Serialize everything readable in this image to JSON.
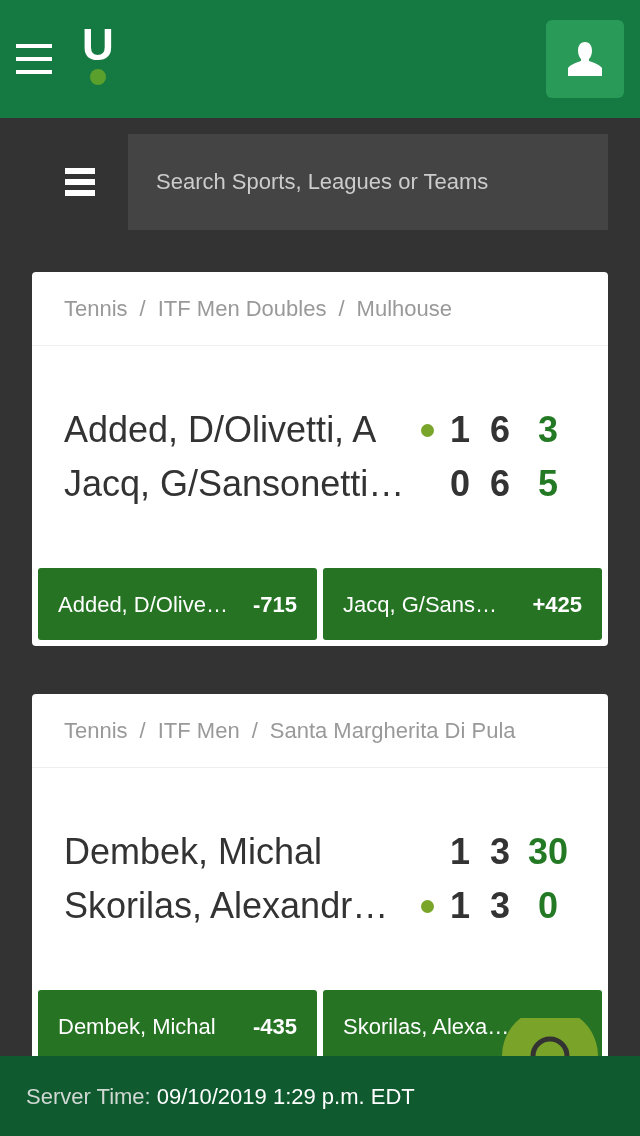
{
  "header": {
    "logo": "U"
  },
  "search": {
    "placeholder": "Search Sports, Leagues or Teams"
  },
  "events": [
    {
      "separator": "/",
      "breadcrumb": [
        "Tennis",
        "ITF Men Doubles",
        "Mulhouse"
      ],
      "players": [
        {
          "name": "Added, D/Olivetti, A",
          "serving": true,
          "sets": [
            "1",
            "6"
          ],
          "points": "3"
        },
        {
          "name": "Jacq, G/Sansonetti…",
          "serving": false,
          "sets": [
            "0",
            "6"
          ],
          "points": "5"
        }
      ],
      "odds": [
        {
          "name": "Added, D/Olive…",
          "price": "-715"
        },
        {
          "name": "Jacq, G/Sans…",
          "price": "+425"
        }
      ]
    },
    {
      "separator": "/",
      "breadcrumb": [
        "Tennis",
        "ITF Men",
        "Santa Margherita Di Pula"
      ],
      "players": [
        {
          "name": "Dembek, Michal",
          "serving": false,
          "sets": [
            "1",
            "3"
          ],
          "points": "30"
        },
        {
          "name": "Skorilas, Alexandr…",
          "serving": true,
          "sets": [
            "1",
            "3"
          ],
          "points": "0"
        }
      ],
      "odds": [
        {
          "name": "Dembek, Michal",
          "price": "-435"
        },
        {
          "name": "Skorilas, Alexa…"
        }
      ]
    }
  ],
  "footer": {
    "label": "Server Time:",
    "value": "09/10/2019 1:29 p.m. EDT"
  }
}
